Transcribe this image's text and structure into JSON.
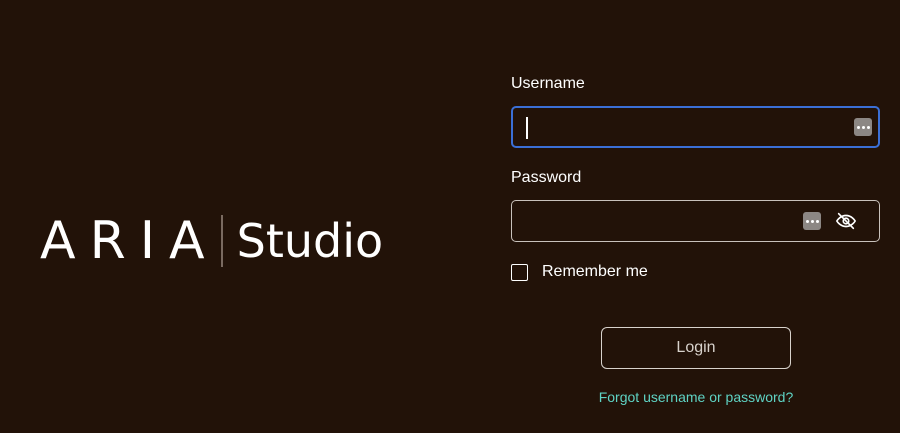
{
  "logo": {
    "wordmark": "ARIA",
    "subtitle": "Studio"
  },
  "form": {
    "username": {
      "label": "Username",
      "value": ""
    },
    "password": {
      "label": "Password",
      "value": ""
    },
    "remember": {
      "label": "Remember me",
      "checked": false
    },
    "login_label": "Login",
    "forgot_label": "Forgot username or password?"
  },
  "colors": {
    "background": "#221208",
    "focus_border": "#3b6fd6",
    "link": "#5fd3c4",
    "text": "#ffffff"
  },
  "icons": {
    "autofill": "more-dots-icon",
    "visibility": "eye-slash-icon"
  }
}
